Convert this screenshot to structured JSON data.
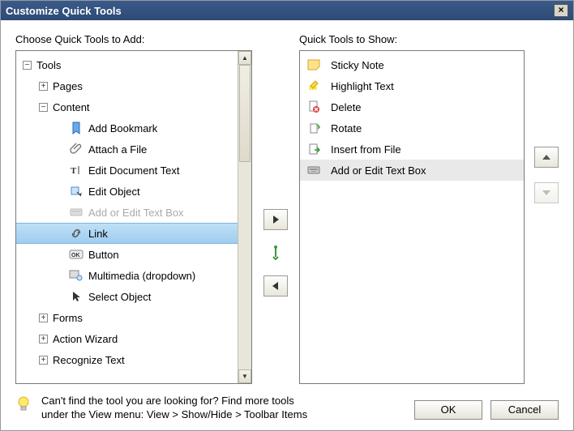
{
  "title": "Customize Quick Tools",
  "left_label": "Choose Quick Tools to Add:",
  "right_label": "Quick Tools to Show:",
  "tree": {
    "root": "Tools",
    "pages": "Pages",
    "content": "Content",
    "add_bookmark": "Add Bookmark",
    "attach_file": "Attach a File",
    "edit_doc_text": "Edit Document Text",
    "edit_object": "Edit Object",
    "add_edit_textbox": "Add or Edit Text Box",
    "link": "Link",
    "button": "Button",
    "multimedia": "Multimedia  (dropdown)",
    "select_object": "Select Object",
    "forms": "Forms",
    "action_wizard": "Action Wizard",
    "recognize_text": "Recognize Text"
  },
  "right_items": {
    "sticky_note": "Sticky Note",
    "highlight_text": "Highlight Text",
    "delete": "Delete",
    "rotate": "Rotate",
    "insert_file": "Insert from File",
    "add_edit_textbox": "Add or Edit Text Box"
  },
  "tip": {
    "line1": "Can't find the tool you are looking for? Find more tools",
    "line2": "under the View menu: View > Show/Hide > Toolbar Items"
  },
  "buttons": {
    "ok": "OK",
    "cancel": "Cancel"
  }
}
